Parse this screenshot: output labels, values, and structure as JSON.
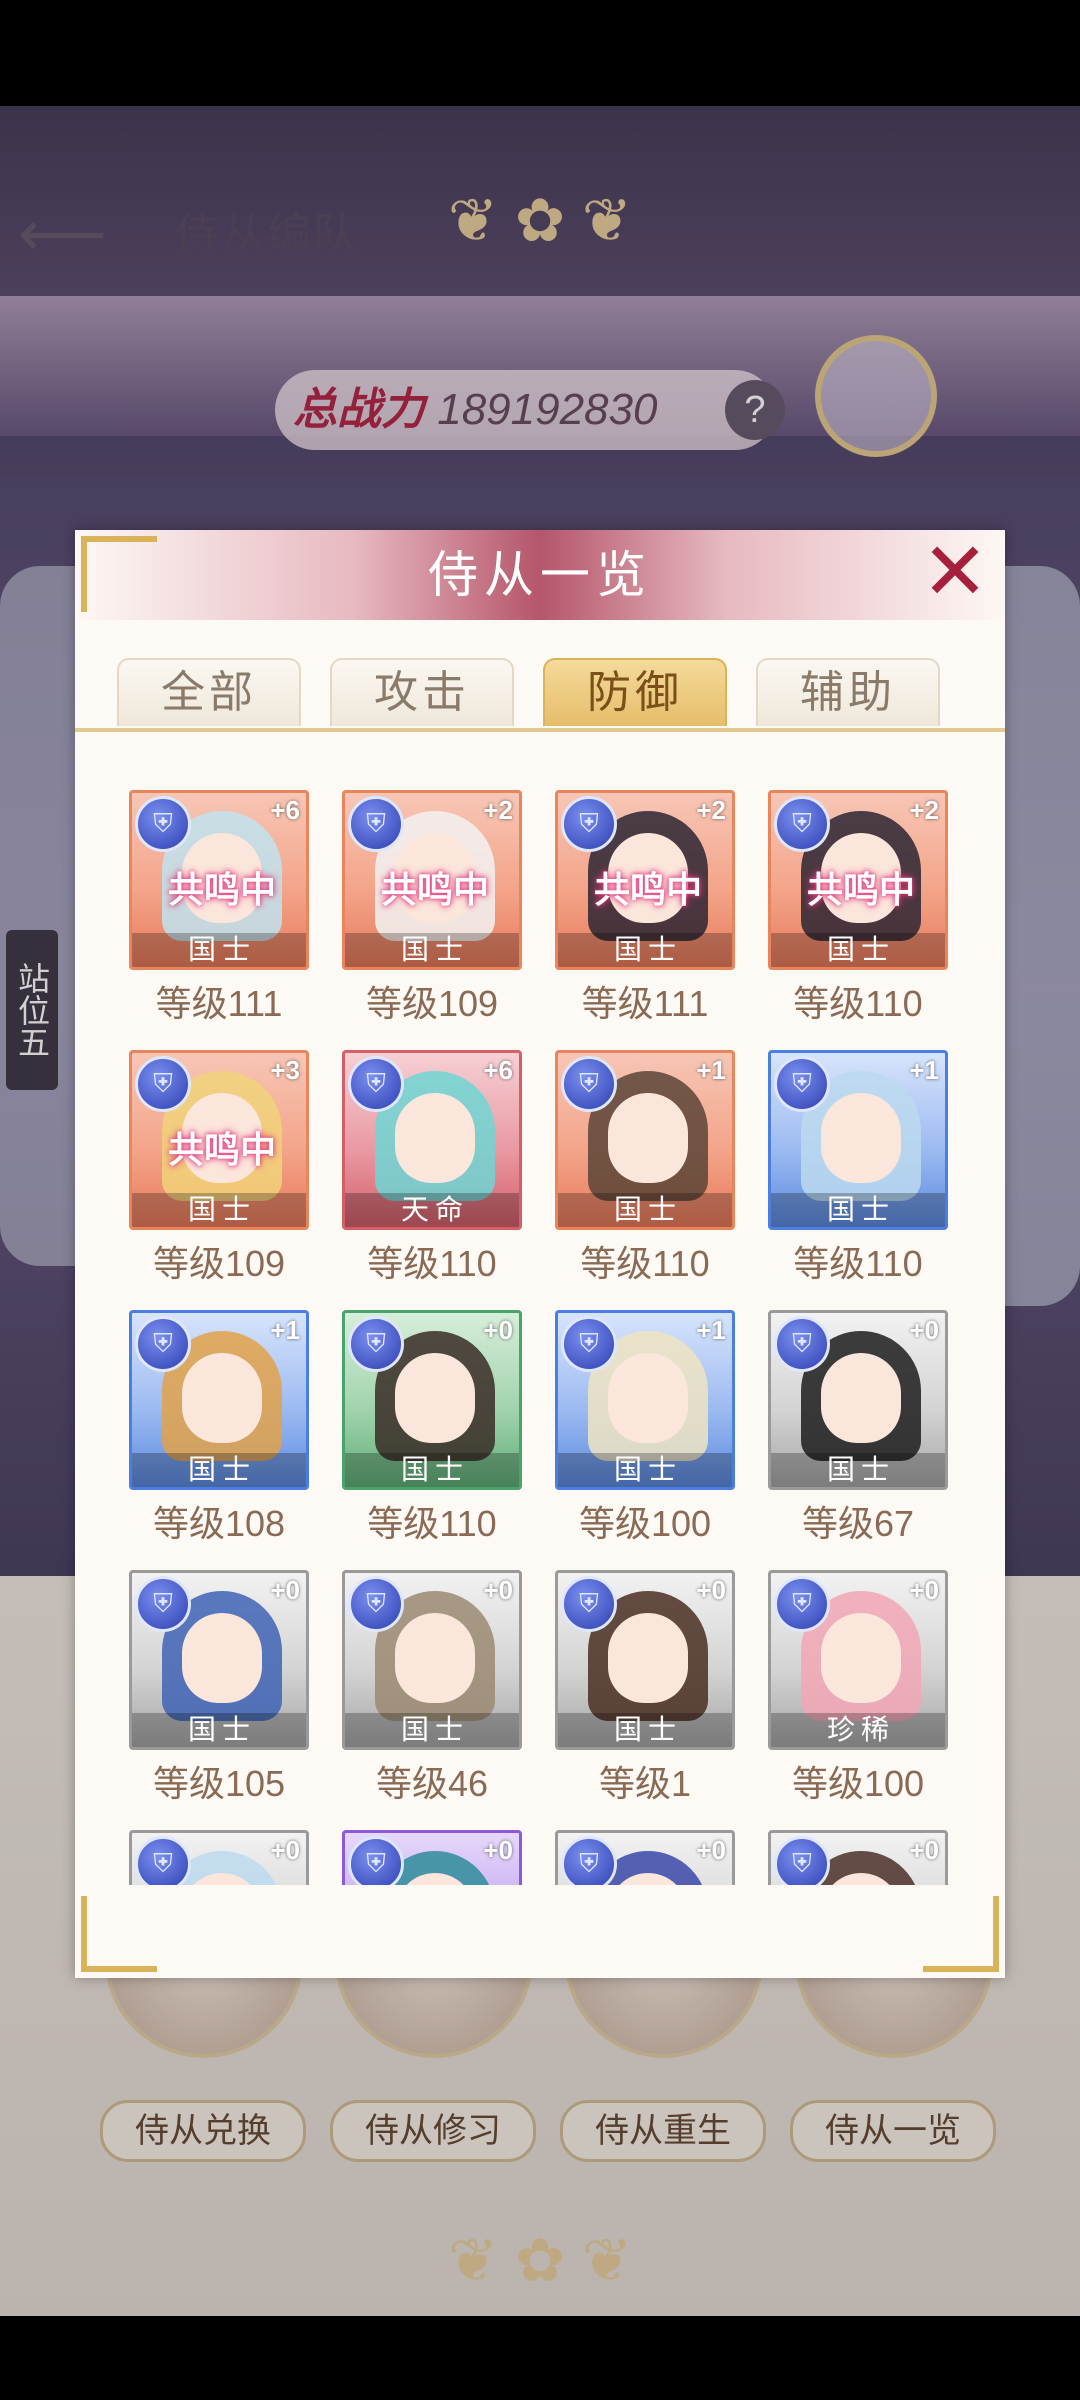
{
  "background": {
    "page_title": "侍从编队",
    "power_label": "总战力",
    "power_value": "189192830",
    "help_symbol": "?",
    "side_label": "站位五",
    "bottom_buttons": [
      "侍从兑换",
      "侍从修习",
      "侍从重生",
      "侍从一览"
    ]
  },
  "modal": {
    "title": "侍从一览",
    "close_symbol": "✕",
    "tabs": [
      {
        "label": "全部",
        "active": false
      },
      {
        "label": "攻击",
        "active": false
      },
      {
        "label": "防御",
        "active": true
      },
      {
        "label": "辅助",
        "active": false
      }
    ],
    "resonance_label": "共鸣中",
    "cards": [
      {
        "plus": "+6",
        "rank": "国士",
        "level": "等级111",
        "quality": "orange",
        "resonance": true,
        "hair": "#bfe3ef"
      },
      {
        "plus": "+2",
        "rank": "国士",
        "level": "等级109",
        "quality": "orange",
        "resonance": true,
        "hair": "#f2f2f2"
      },
      {
        "plus": "+2",
        "rank": "国士",
        "level": "等级111",
        "quality": "orange",
        "resonance": true,
        "hair": "#2b2433"
      },
      {
        "plus": "+2",
        "rank": "国士",
        "level": "等级110",
        "quality": "orange",
        "resonance": true,
        "hair": "#2b2433"
      },
      {
        "plus": "+3",
        "rank": "国士",
        "level": "等级109",
        "quality": "orange",
        "resonance": true,
        "hair": "#f1d27a"
      },
      {
        "plus": "+6",
        "rank": "天命",
        "level": "等级110",
        "quality": "red",
        "resonance": false,
        "hair": "#6fd6d3"
      },
      {
        "plus": "+1",
        "rank": "国士",
        "level": "等级110",
        "quality": "orange",
        "resonance": false,
        "hair": "#5a4436"
      },
      {
        "plus": "+1",
        "rank": "国士",
        "level": "等级110",
        "quality": "blue",
        "resonance": false,
        "hair": "#bcd9ee"
      },
      {
        "plus": "+1",
        "rank": "国士",
        "level": "等级108",
        "quality": "blue",
        "resonance": false,
        "hair": "#e2a24a"
      },
      {
        "plus": "+0",
        "rank": "国士",
        "level": "等级110",
        "quality": "green",
        "resonance": false,
        "hair": "#3a2c26"
      },
      {
        "plus": "+1",
        "rank": "国士",
        "level": "等级100",
        "quality": "blue",
        "resonance": false,
        "hair": "#efe4c2"
      },
      {
        "plus": "+0",
        "rank": "国士",
        "level": "等级67",
        "quality": "gray",
        "resonance": false,
        "hair": "#1c1c1c"
      },
      {
        "plus": "+0",
        "rank": "国士",
        "level": "等级105",
        "quality": "gray",
        "resonance": false,
        "hair": "#3f63b4"
      },
      {
        "plus": "+0",
        "rank": "国士",
        "level": "等级46",
        "quality": "gray",
        "resonance": false,
        "hair": "#9a8a70"
      },
      {
        "plus": "+0",
        "rank": "国士",
        "level": "等级1",
        "quality": "gray",
        "resonance": false,
        "hair": "#4a2e22"
      },
      {
        "plus": "+0",
        "rank": "珍稀",
        "level": "等级100",
        "quality": "gray",
        "resonance": false,
        "hair": "#f2a6b6"
      },
      {
        "plus": "+0",
        "rank": "",
        "level": "",
        "quality": "gray",
        "resonance": false,
        "hair": "#bcd9ee"
      },
      {
        "plus": "+0",
        "rank": "",
        "level": "",
        "quality": "purple",
        "resonance": false,
        "hair": "#2f8c9a"
      },
      {
        "plus": "+0",
        "rank": "",
        "level": "",
        "quality": "gray",
        "resonance": false,
        "hair": "#3a48a8"
      },
      {
        "plus": "+0",
        "rank": "",
        "level": "",
        "quality": "gray",
        "resonance": false,
        "hair": "#4a3028"
      }
    ]
  }
}
